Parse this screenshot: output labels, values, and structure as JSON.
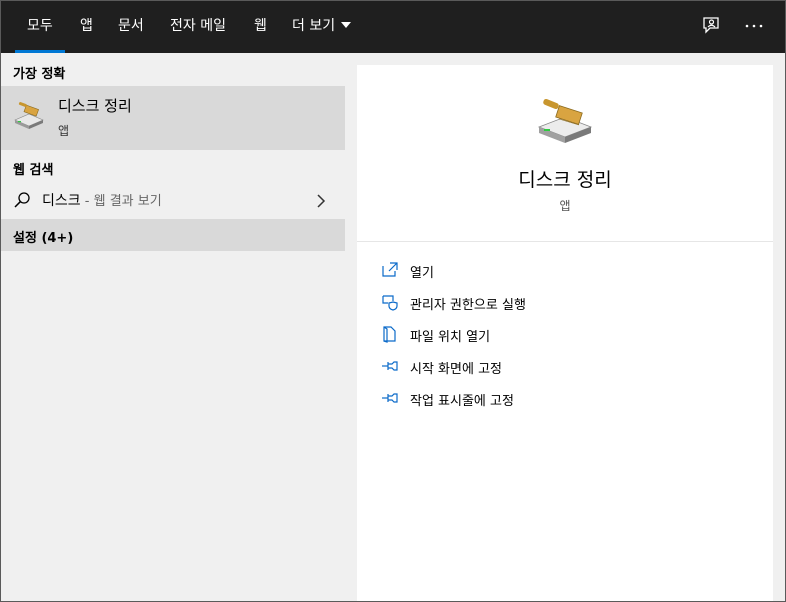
{
  "tabs": [
    {
      "label": "모두",
      "active": true
    },
    {
      "label": "앱"
    },
    {
      "label": "문서"
    },
    {
      "label": "전자 메일"
    },
    {
      "label": "웹"
    },
    {
      "label": "더 보기"
    }
  ],
  "topbar_icons": [
    "feedback-icon",
    "more-options-icon"
  ],
  "left": {
    "best_match_header": "가장 정확",
    "best_match": {
      "title": "디스크 정리",
      "subtitle": "앱",
      "icon": "disk-cleanup-icon"
    },
    "web_search_header": "웹 검색",
    "web_search": {
      "query": "디스크",
      "hint": " - 웹 결과 보기",
      "icon": "search-icon"
    },
    "settings_label": "설정 (4+)"
  },
  "right": {
    "app_title": "디스크 정리",
    "app_subtitle": "앱",
    "actions": [
      {
        "label": "열기",
        "icon": "open-icon"
      },
      {
        "label": "관리자 권한으로 실행",
        "icon": "shield-icon"
      },
      {
        "label": "파일 위치 열기",
        "icon": "file-location-icon"
      },
      {
        "label": "시작 화면에 고정",
        "icon": "pin-icon"
      },
      {
        "label": "작업 표시줄에 고정",
        "icon": "pin-icon"
      }
    ]
  },
  "colors": {
    "accent": "#0078d4",
    "topbar": "#1f1f1f",
    "selected_row": "#d9d9d9"
  }
}
